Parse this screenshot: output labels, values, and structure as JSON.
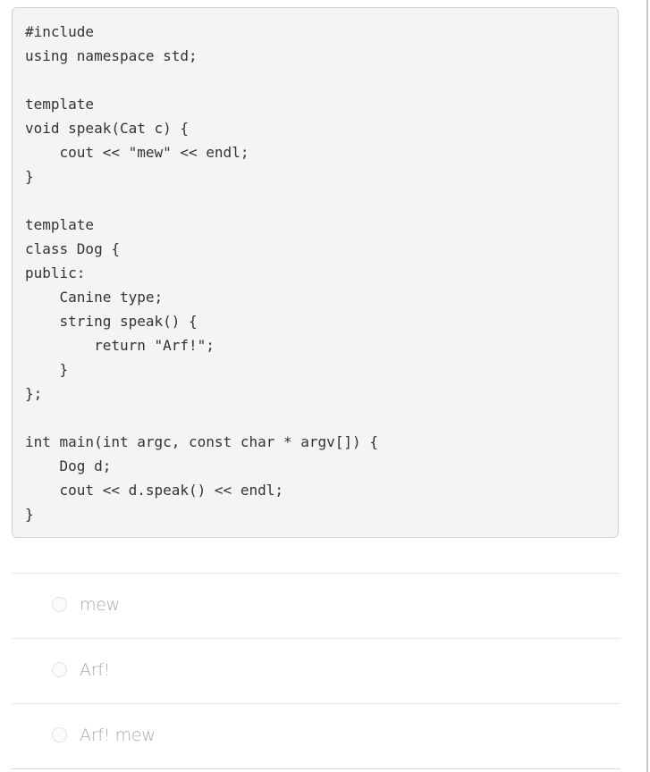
{
  "question": {
    "code_lines": [
      "#include",
      "using namespace std;",
      "",
      "template",
      "void speak(Cat c) {",
      "    cout << \"mew\" << endl;",
      "}",
      "",
      "template",
      "class Dog {",
      "public:",
      "    Canine type;",
      "    string speak() {",
      "        return \"Arf!\";",
      "    }",
      "};",
      "",
      "int main(int argc, const char * argv[]) {",
      "    Dog d;",
      "    cout << d.speak() << endl;",
      "}"
    ]
  },
  "answers": {
    "options": [
      {
        "label": "mew",
        "selected": false
      },
      {
        "label": "Arf!",
        "selected": false
      },
      {
        "label": "Arf! mew",
        "selected": false
      }
    ]
  }
}
